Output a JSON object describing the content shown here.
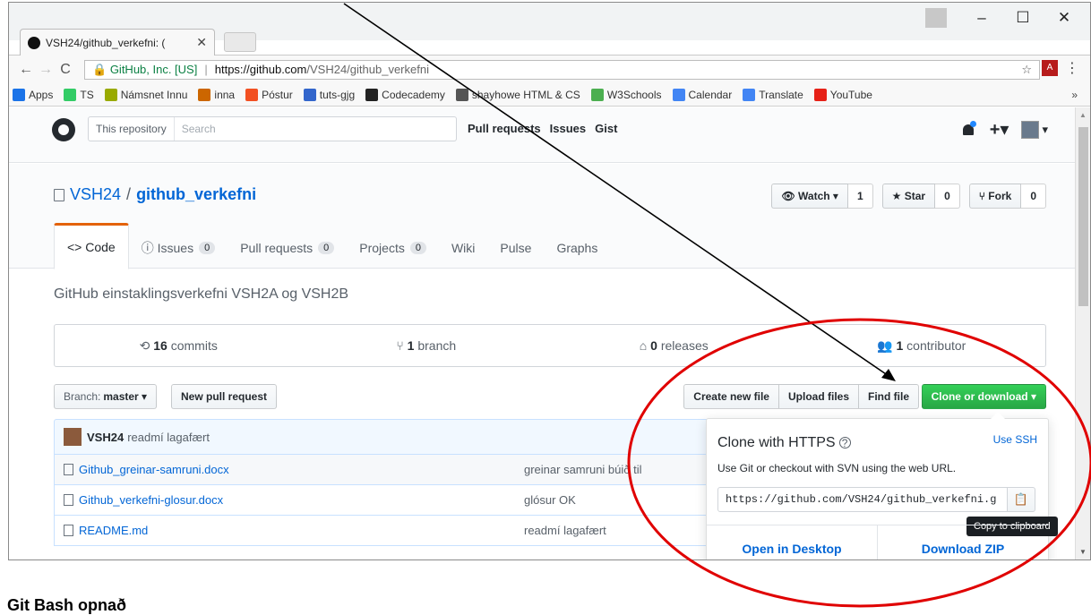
{
  "browser": {
    "tab_title": "VSH24/github_verkefni: (",
    "tab_close": "✕",
    "win_min": "–",
    "win_max": "☐",
    "win_close": "✕",
    "back": "←",
    "forward": "→",
    "reload": "C",
    "secure_label": "GitHub, Inc. [US]",
    "url_host": "https://github.com",
    "url_path": "/VSH24/github_verkefni",
    "star": "☆",
    "menu": "⋮"
  },
  "bookmarks": [
    {
      "label": "Apps",
      "icon": "apps-icon",
      "color": "#1a73e8"
    },
    {
      "label": "TS",
      "icon": "ts-icon",
      "color": "#3c6"
    },
    {
      "label": "Námsnet Innu",
      "icon": "innu-icon",
      "color": "#9a0"
    },
    {
      "label": "inna",
      "icon": "inna-icon",
      "color": "#c60"
    },
    {
      "label": "Póstur",
      "icon": "windows-icon",
      "color": "#f25022"
    },
    {
      "label": "tuts-gjg",
      "icon": "tuts-icon",
      "color": "#36c"
    },
    {
      "label": "Codecademy",
      "icon": "codecademy-icon",
      "color": "#222"
    },
    {
      "label": "shayhowe HTML & CS",
      "icon": "code-icon",
      "color": "#555"
    },
    {
      "label": "W3Schools",
      "icon": "w3-icon",
      "color": "#4caf50"
    },
    {
      "label": "Calendar",
      "icon": "google-icon",
      "color": "#4285f4"
    },
    {
      "label": "Translate",
      "icon": "translate-icon",
      "color": "#4285f4"
    },
    {
      "label": "YouTube",
      "icon": "youtube-icon",
      "color": "#e62117"
    }
  ],
  "bookmarks_more": "»",
  "gh": {
    "search_scope": "This repository",
    "search_placeholder": "Search",
    "nav": [
      "Pull requests",
      "Issues",
      "Gist"
    ],
    "plus": "+▾",
    "avatar_caret": "▾"
  },
  "repo": {
    "owner": "VSH24",
    "name": "github_verkefni",
    "watch_label": "Watch ▾",
    "watch_count": "1",
    "star_label": "★ Star",
    "star_count": "0",
    "fork_label": "Fork",
    "fork_count": "0",
    "description": "GitHub einstaklingsverkefni VSH2A og VSH2B"
  },
  "tabs": [
    {
      "label": "<> Code",
      "count": ""
    },
    {
      "label": "ⓘ Issues",
      "count": "0"
    },
    {
      "label": "Pull requests",
      "count": "0"
    },
    {
      "label": "Projects",
      "count": "0"
    },
    {
      "label": "Wiki",
      "count": ""
    },
    {
      "label": "Pulse",
      "count": ""
    },
    {
      "label": "Graphs",
      "count": ""
    }
  ],
  "summary": {
    "commits_num": "16",
    "commits_label": "commits",
    "branch_num": "1",
    "branch_label": "branch",
    "releases_num": "0",
    "releases_label": "releases",
    "contrib_num": "1",
    "contrib_label": "contributor"
  },
  "filebar": {
    "branch_prefix": "Branch:",
    "branch_name": "master ▾",
    "new_pr": "New pull request",
    "create_file": "Create new file",
    "upload": "Upload files",
    "find": "Find file",
    "clone": "Clone or download ▾"
  },
  "commit": {
    "author": "VSH24",
    "message": "readmí lagafært"
  },
  "files": [
    {
      "name": "Github_greinar-samruni.docx",
      "msg": "greinar samruni búið til"
    },
    {
      "name": "Github_verkefni-glosur.docx",
      "msg": "glósur OK"
    },
    {
      "name": "README.md",
      "msg": "readmí lagafært"
    }
  ],
  "clone": {
    "title": "Clone with HTTPS",
    "help_icon": "?",
    "use_ssh": "Use SSH",
    "help": "Use Git or checkout with SVN using the web URL.",
    "url": "https://github.com/VSH24/github_verkefni.g",
    "copy_icon": "📋",
    "tooltip": "Copy to clipboard",
    "open_desktop": "Open in Desktop",
    "download_zip": "Download ZIP"
  },
  "annotation": {
    "circle_color": "#e00000",
    "arrow_color": "#000000"
  },
  "caption": {
    "bottom": "Git Bash opnað"
  }
}
